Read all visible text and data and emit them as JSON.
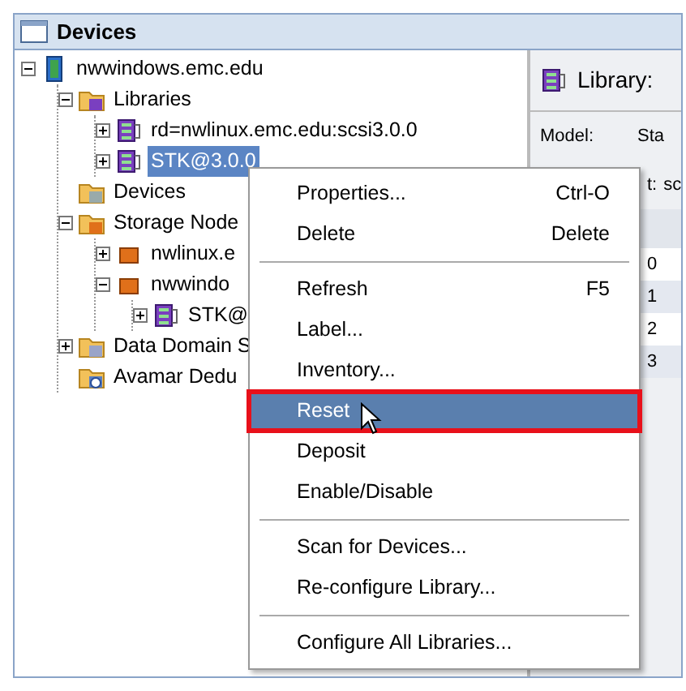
{
  "window": {
    "title": "Devices"
  },
  "tree": [
    {
      "label": "nwwindows.emc.edu",
      "kind": "server",
      "expanded": true,
      "selected": false,
      "children": [
        {
          "label": "Libraries",
          "kind": "library-folder",
          "expanded": true,
          "selected": false,
          "children": [
            {
              "label": "rd=nwlinux.emc.edu:scsi3.0.0",
              "kind": "library",
              "expanded": false,
              "selected": false
            },
            {
              "label": "STK@3.0.0",
              "kind": "library",
              "expanded": false,
              "selected": true
            }
          ]
        },
        {
          "label": "Devices",
          "kind": "device-folder",
          "selected": false
        },
        {
          "label": "Storage Node",
          "kind": "node-folder",
          "expanded": true,
          "selected": false,
          "children": [
            {
              "label": "nwlinux.e",
              "kind": "node",
              "expanded": false,
              "selected": false
            },
            {
              "label": "nwwindo",
              "kind": "node",
              "expanded": true,
              "selected": false,
              "children": [
                {
                  "label": "STK@",
                  "kind": "library",
                  "expanded": false,
                  "selected": false
                }
              ]
            }
          ]
        },
        {
          "label": "Data Domain S",
          "kind": "dd-folder",
          "expanded": false,
          "selected": false
        },
        {
          "label": "Avamar Dedu",
          "kind": "avamar-folder",
          "selected": false
        }
      ]
    }
  ],
  "detail": {
    "title": "Library:",
    "fields": [
      {
        "label": "Model:",
        "value": "Sta"
      },
      {
        "label": "t:",
        "value": "sc"
      }
    ],
    "rows": [
      "0",
      "1",
      "2",
      "3"
    ]
  },
  "context_menu": [
    {
      "kind": "item",
      "label": "Properties...",
      "shortcut": "Ctrl-O",
      "selected": false,
      "outlined": false
    },
    {
      "kind": "item",
      "label": "Delete",
      "shortcut": "Delete",
      "selected": false,
      "outlined": false
    },
    {
      "kind": "separator"
    },
    {
      "kind": "item",
      "label": "Refresh",
      "shortcut": "F5",
      "selected": false,
      "outlined": false
    },
    {
      "kind": "item",
      "label": "Label...",
      "selected": false,
      "outlined": false
    },
    {
      "kind": "item",
      "label": "Inventory...",
      "selected": false,
      "outlined": false
    },
    {
      "kind": "item",
      "label": "Reset",
      "selected": true,
      "outlined": true
    },
    {
      "kind": "item",
      "label": "Deposit",
      "selected": false,
      "outlined": false
    },
    {
      "kind": "item",
      "label": "Enable/Disable",
      "selected": false,
      "outlined": false
    },
    {
      "kind": "separator"
    },
    {
      "kind": "item",
      "label": "Scan for Devices...",
      "selected": false,
      "outlined": false
    },
    {
      "kind": "item",
      "label": "Re-configure Library...",
      "selected": false,
      "outlined": false
    },
    {
      "kind": "separator"
    },
    {
      "kind": "item",
      "label": "Configure All Libraries...",
      "selected": false,
      "outlined": false
    }
  ]
}
